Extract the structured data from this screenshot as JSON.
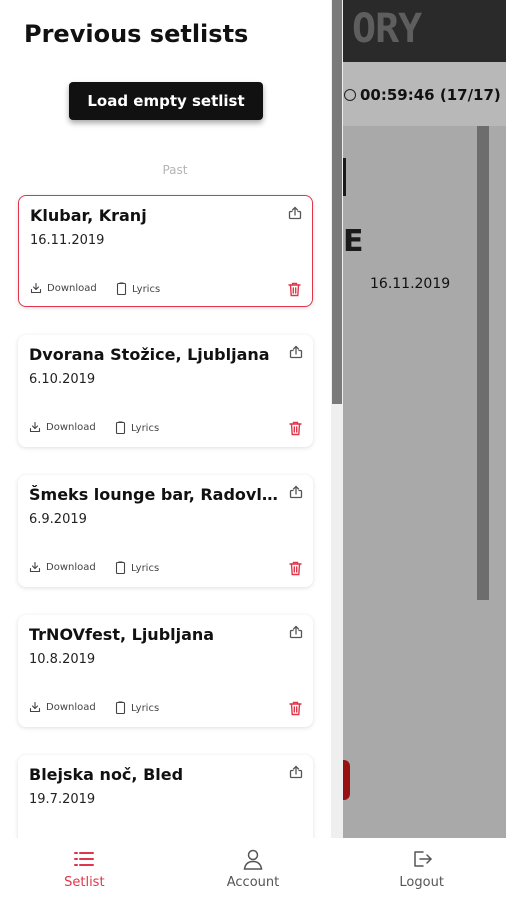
{
  "background": {
    "logo": "ORY",
    "timer": "00:59:46 (17/17)",
    "big_letter": "E",
    "date": "16.11.2019"
  },
  "drawer": {
    "title": "Previous setlists",
    "load_empty_label": "Load empty setlist",
    "section_label": "Past",
    "setlists": [
      {
        "name": "Klubar, Kranj",
        "date": "16.11.2019",
        "selected": true
      },
      {
        "name": "Dvorana Stožice, Ljubljana",
        "date": "6.10.2019",
        "selected": false
      },
      {
        "name": "Šmeks lounge bar, Radovljica",
        "date": "6.9.2019",
        "selected": false
      },
      {
        "name": "TrNOVfest, Ljubljana",
        "date": "10.8.2019",
        "selected": false
      },
      {
        "name": "Blejska noč, Bled",
        "date": "19.7.2019",
        "selected": false
      }
    ],
    "download_label": "Download",
    "lyrics_label": "Lyrics"
  },
  "nav": {
    "items": [
      {
        "label": "Setlist",
        "icon": "list-icon",
        "active": true
      },
      {
        "label": "Account",
        "icon": "user-icon",
        "active": false
      },
      {
        "label": "Logout",
        "icon": "logout-icon",
        "active": false
      }
    ]
  },
  "colors": {
    "accent": "#e0364a",
    "button_bg": "#111111",
    "overlay_gray": "#9a9a9a"
  }
}
